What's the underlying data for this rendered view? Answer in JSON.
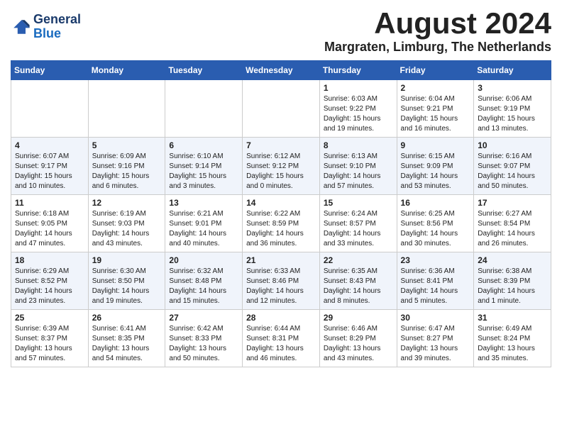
{
  "logo": {
    "line1": "General",
    "line2": "Blue"
  },
  "title": "August 2024",
  "location": "Margraten, Limburg, The Netherlands",
  "days_of_week": [
    "Sunday",
    "Monday",
    "Tuesday",
    "Wednesday",
    "Thursday",
    "Friday",
    "Saturday"
  ],
  "weeks": [
    [
      {
        "day": "",
        "info": ""
      },
      {
        "day": "",
        "info": ""
      },
      {
        "day": "",
        "info": ""
      },
      {
        "day": "",
        "info": ""
      },
      {
        "day": "1",
        "info": "Sunrise: 6:03 AM\nSunset: 9:22 PM\nDaylight: 15 hours\nand 19 minutes."
      },
      {
        "day": "2",
        "info": "Sunrise: 6:04 AM\nSunset: 9:21 PM\nDaylight: 15 hours\nand 16 minutes."
      },
      {
        "day": "3",
        "info": "Sunrise: 6:06 AM\nSunset: 9:19 PM\nDaylight: 15 hours\nand 13 minutes."
      }
    ],
    [
      {
        "day": "4",
        "info": "Sunrise: 6:07 AM\nSunset: 9:17 PM\nDaylight: 15 hours\nand 10 minutes."
      },
      {
        "day": "5",
        "info": "Sunrise: 6:09 AM\nSunset: 9:16 PM\nDaylight: 15 hours\nand 6 minutes."
      },
      {
        "day": "6",
        "info": "Sunrise: 6:10 AM\nSunset: 9:14 PM\nDaylight: 15 hours\nand 3 minutes."
      },
      {
        "day": "7",
        "info": "Sunrise: 6:12 AM\nSunset: 9:12 PM\nDaylight: 15 hours\nand 0 minutes."
      },
      {
        "day": "8",
        "info": "Sunrise: 6:13 AM\nSunset: 9:10 PM\nDaylight: 14 hours\nand 57 minutes."
      },
      {
        "day": "9",
        "info": "Sunrise: 6:15 AM\nSunset: 9:09 PM\nDaylight: 14 hours\nand 53 minutes."
      },
      {
        "day": "10",
        "info": "Sunrise: 6:16 AM\nSunset: 9:07 PM\nDaylight: 14 hours\nand 50 minutes."
      }
    ],
    [
      {
        "day": "11",
        "info": "Sunrise: 6:18 AM\nSunset: 9:05 PM\nDaylight: 14 hours\nand 47 minutes."
      },
      {
        "day": "12",
        "info": "Sunrise: 6:19 AM\nSunset: 9:03 PM\nDaylight: 14 hours\nand 43 minutes."
      },
      {
        "day": "13",
        "info": "Sunrise: 6:21 AM\nSunset: 9:01 PM\nDaylight: 14 hours\nand 40 minutes."
      },
      {
        "day": "14",
        "info": "Sunrise: 6:22 AM\nSunset: 8:59 PM\nDaylight: 14 hours\nand 36 minutes."
      },
      {
        "day": "15",
        "info": "Sunrise: 6:24 AM\nSunset: 8:57 PM\nDaylight: 14 hours\nand 33 minutes."
      },
      {
        "day": "16",
        "info": "Sunrise: 6:25 AM\nSunset: 8:56 PM\nDaylight: 14 hours\nand 30 minutes."
      },
      {
        "day": "17",
        "info": "Sunrise: 6:27 AM\nSunset: 8:54 PM\nDaylight: 14 hours\nand 26 minutes."
      }
    ],
    [
      {
        "day": "18",
        "info": "Sunrise: 6:29 AM\nSunset: 8:52 PM\nDaylight: 14 hours\nand 23 minutes."
      },
      {
        "day": "19",
        "info": "Sunrise: 6:30 AM\nSunset: 8:50 PM\nDaylight: 14 hours\nand 19 minutes."
      },
      {
        "day": "20",
        "info": "Sunrise: 6:32 AM\nSunset: 8:48 PM\nDaylight: 14 hours\nand 15 minutes."
      },
      {
        "day": "21",
        "info": "Sunrise: 6:33 AM\nSunset: 8:46 PM\nDaylight: 14 hours\nand 12 minutes."
      },
      {
        "day": "22",
        "info": "Sunrise: 6:35 AM\nSunset: 8:43 PM\nDaylight: 14 hours\nand 8 minutes."
      },
      {
        "day": "23",
        "info": "Sunrise: 6:36 AM\nSunset: 8:41 PM\nDaylight: 14 hours\nand 5 minutes."
      },
      {
        "day": "24",
        "info": "Sunrise: 6:38 AM\nSunset: 8:39 PM\nDaylight: 14 hours\nand 1 minute."
      }
    ],
    [
      {
        "day": "25",
        "info": "Sunrise: 6:39 AM\nSunset: 8:37 PM\nDaylight: 13 hours\nand 57 minutes."
      },
      {
        "day": "26",
        "info": "Sunrise: 6:41 AM\nSunset: 8:35 PM\nDaylight: 13 hours\nand 54 minutes."
      },
      {
        "day": "27",
        "info": "Sunrise: 6:42 AM\nSunset: 8:33 PM\nDaylight: 13 hours\nand 50 minutes."
      },
      {
        "day": "28",
        "info": "Sunrise: 6:44 AM\nSunset: 8:31 PM\nDaylight: 13 hours\nand 46 minutes."
      },
      {
        "day": "29",
        "info": "Sunrise: 6:46 AM\nSunset: 8:29 PM\nDaylight: 13 hours\nand 43 minutes."
      },
      {
        "day": "30",
        "info": "Sunrise: 6:47 AM\nSunset: 8:27 PM\nDaylight: 13 hours\nand 39 minutes."
      },
      {
        "day": "31",
        "info": "Sunrise: 6:49 AM\nSunset: 8:24 PM\nDaylight: 13 hours\nand 35 minutes."
      }
    ]
  ]
}
